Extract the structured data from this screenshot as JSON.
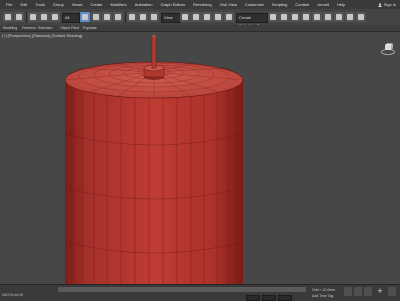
{
  "menubar": {
    "items": [
      "File",
      "Edit",
      "Tools",
      "Group",
      "Views",
      "Create",
      "Modifiers",
      "Animation",
      "Graph Editors",
      "Rendering",
      "Civil View",
      "Customize",
      "Scripting",
      "Content",
      "Arnold",
      "Help"
    ],
    "signin_label": "Sign In"
  },
  "toolbar": {
    "selection_filter": "All",
    "reference_coord": "View",
    "named_selection": "Create Selection Se"
  },
  "ribbon": {
    "tabs": [
      "Modeling",
      "Freeform",
      "Selection",
      "Object Paint",
      "Populate"
    ]
  },
  "viewport": {
    "label": "[+] [Perspective] [Standard] [Default Shading]",
    "object_color": "#b8352b",
    "background_color": "#474747"
  },
  "status": {
    "left_text": "MAXScript Mi",
    "grid_text": "Grid = 10.0mm",
    "add_time_tag": "Add Time Tag"
  },
  "icons": [
    "undo-icon",
    "redo-icon",
    "link-icon",
    "unlink-icon",
    "bind-spacewarp-icon",
    "select-icon",
    "select-by-name-icon",
    "rect-selection-icon",
    "window-crossing-icon",
    "move-icon",
    "rotate-icon",
    "scale-icon",
    "pivot-icon",
    "snap-icon",
    "angle-snap-icon",
    "percent-snap-icon",
    "spinner-snap-icon",
    "mirror-icon",
    "align-icon",
    "layer-icon",
    "curve-editor-icon",
    "schematic-icon",
    "material-editor-icon",
    "render-setup-icon",
    "render-frame-icon",
    "render-icon",
    "viewcube-icon",
    "add-icon"
  ]
}
